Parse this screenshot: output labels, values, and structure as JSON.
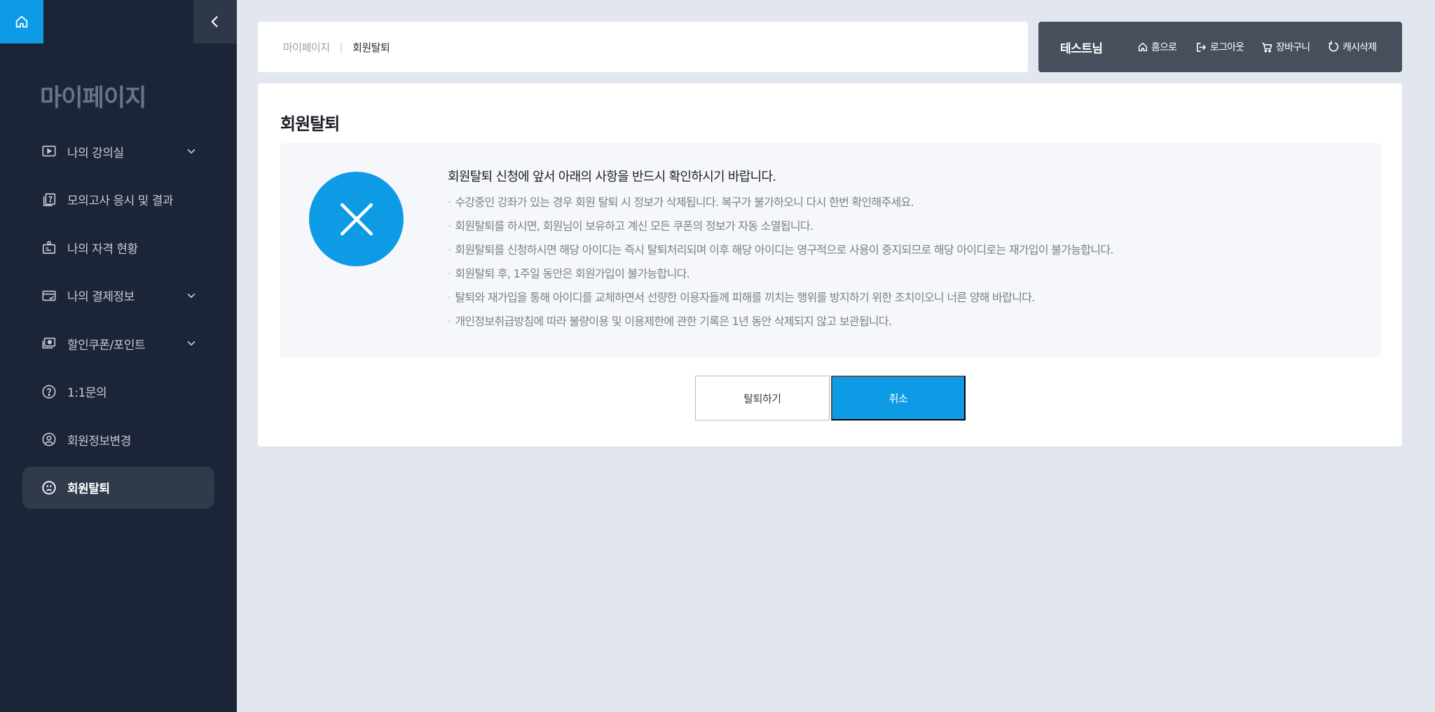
{
  "sidebar": {
    "title": "마이페이지",
    "items": [
      {
        "label": "나의 강의실",
        "icon": "play-screen-icon",
        "expandable": true
      },
      {
        "label": "모의고사 응시 및 결과",
        "icon": "quiz-icon",
        "expandable": false
      },
      {
        "label": "나의 자격 현황",
        "icon": "certificate-icon",
        "expandable": false
      },
      {
        "label": "나의 결제정보",
        "icon": "card-icon",
        "expandable": true
      },
      {
        "label": "할인쿠폰/포인트",
        "icon": "coupon-icon",
        "expandable": true
      },
      {
        "label": "1:1문의",
        "icon": "question-icon",
        "expandable": false
      },
      {
        "label": "회원정보변경",
        "icon": "user-circle-icon",
        "expandable": false
      },
      {
        "label": "회원탈퇴",
        "icon": "sad-face-icon",
        "expandable": false,
        "active": true
      }
    ]
  },
  "breadcrumb": {
    "first": "마이페이지",
    "separator": "|",
    "current": "회원탈퇴"
  },
  "userbar": {
    "name": "테스트님",
    "links": [
      {
        "label": "홈으로",
        "icon": "home-icon"
      },
      {
        "label": "로그아웃",
        "icon": "logout-icon"
      },
      {
        "label": "장바구니",
        "icon": "cart-icon"
      },
      {
        "label": "캐시삭제",
        "icon": "refresh-icon"
      }
    ]
  },
  "main": {
    "title": "회원탈퇴",
    "notice_heading": "회원탈퇴 신청에 앞서 아래의 사항을 반드시 확인하시기 바랍니다.",
    "notices": [
      "수강중인 강좌가 있는 경우 회원 탈퇴 시 정보가 삭제됩니다. 복구가 불가하오니 다시 한번 확인해주세요.",
      "회원탈퇴를 하시면, 회원님이 보유하고 계신 모든 쿠폰의 정보가 자동 소멸됩니다.",
      "회원탈퇴를 신청하시면 해당 아이디는 즉시 탈퇴처리되며 이후 해당 아이디는 영구적으로 사용이 중지되므로 해당 아이디로는 재가입이 불가능합니다.",
      "회원탈퇴 후, 1주일 동안은 회원가입이 불가능합니다.",
      "탈퇴와 재가입을 통해 아이디를 교체하면서 선량한 이용자들께 피해를 끼치는 행위를 방지하기 위한 조치이오니 너른 양해 바랍니다.",
      "개인정보취급방침에 따라 불량이용 및 이용제한에 관한 기록은 1년 동안 삭제되지 않고 보관됩니다."
    ],
    "bullet": "·",
    "withdraw_label": "탈퇴하기",
    "cancel_label": "취소"
  },
  "colors": {
    "accent": "#0d9be6",
    "sidebar_bg": "#1c2538",
    "userbar_bg": "#474e5c",
    "page_bg": "#e2e6ee"
  }
}
